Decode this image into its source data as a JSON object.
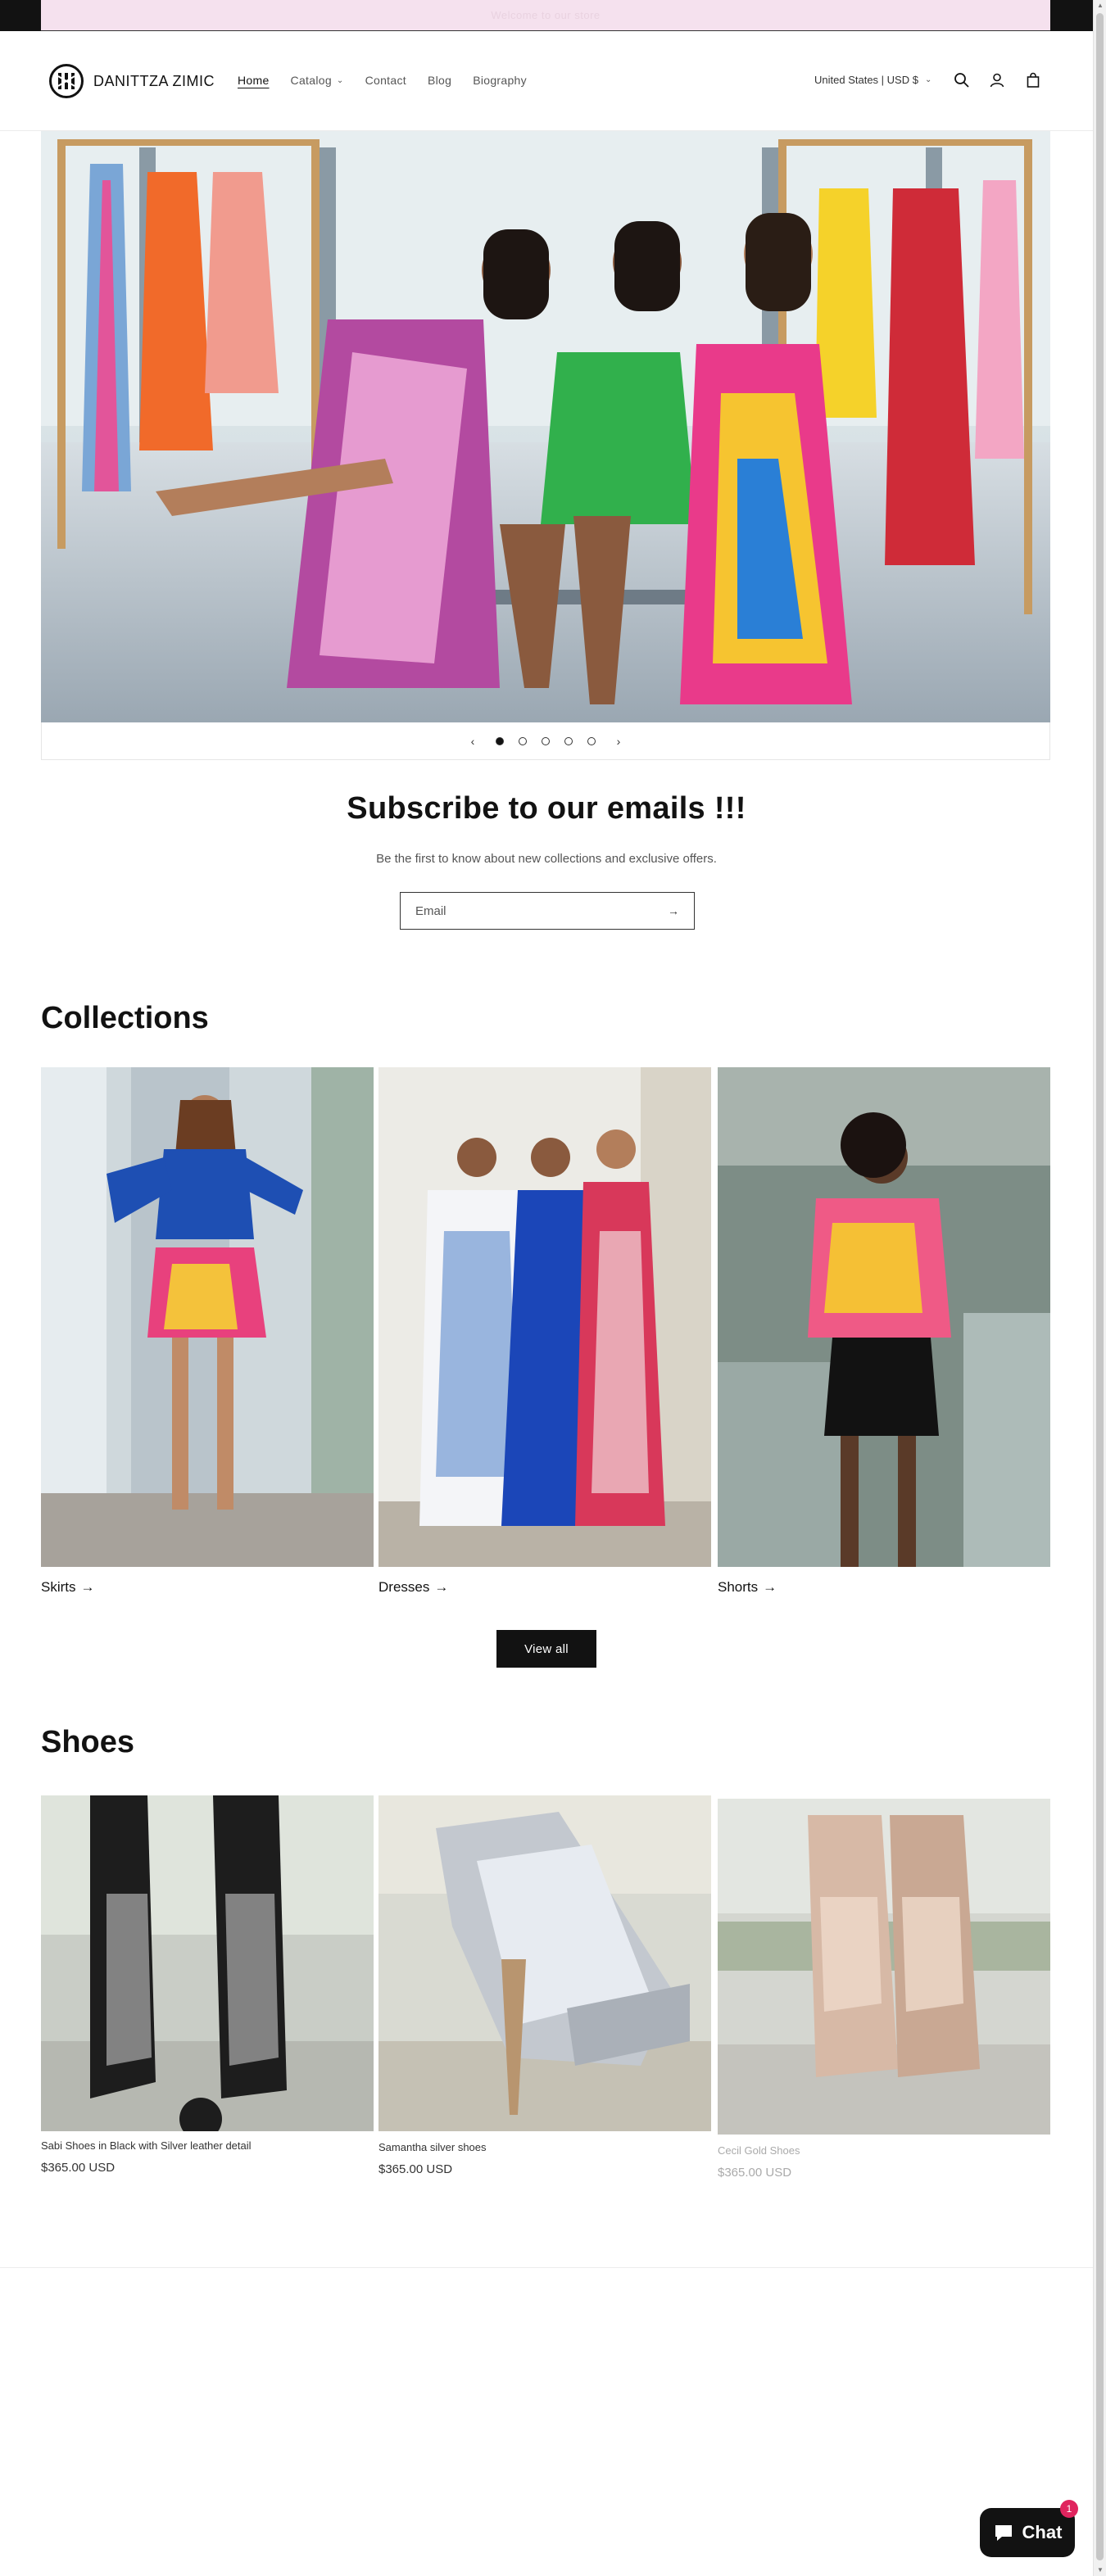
{
  "announcement": {
    "text": "Welcome to our store"
  },
  "brand": {
    "name": "DANITTZA ZIMIC"
  },
  "nav": {
    "items": [
      {
        "label": "Home",
        "active": true
      },
      {
        "label": "Catalog",
        "has_dropdown": true
      },
      {
        "label": "Contact"
      },
      {
        "label": "Blog"
      },
      {
        "label": "Biography"
      }
    ]
  },
  "header": {
    "country_selector": "United States | USD $",
    "icons": [
      "search-icon",
      "account-icon",
      "cart-icon"
    ]
  },
  "slideshow": {
    "slide_count": 5,
    "active_index": 0
  },
  "newsletter": {
    "title": "Subscribe to our emails !!!",
    "subtitle": "Be the first to know about new collections and exclusive offers.",
    "email_placeholder": "Email"
  },
  "collections": {
    "title": "Collections",
    "items": [
      {
        "label": "Skirts"
      },
      {
        "label": "Dresses"
      },
      {
        "label": "Shorts"
      }
    ],
    "view_all_label": "View all"
  },
  "shoes": {
    "title": "Shoes",
    "products": [
      {
        "name": "Sabi Shoes in Black with Silver leather detail",
        "price": "$365.00 USD"
      },
      {
        "name": "Samantha silver shoes",
        "price": "$365.00 USD"
      },
      {
        "name": "Cecil Gold Shoes",
        "price": "$365.00 USD"
      }
    ]
  },
  "chat": {
    "label": "Chat",
    "badge": "1"
  },
  "colors": {
    "announcement_bg": "#f5e1ee",
    "text": "#121212",
    "button_bg": "#121212",
    "badge": "#e0245e"
  }
}
